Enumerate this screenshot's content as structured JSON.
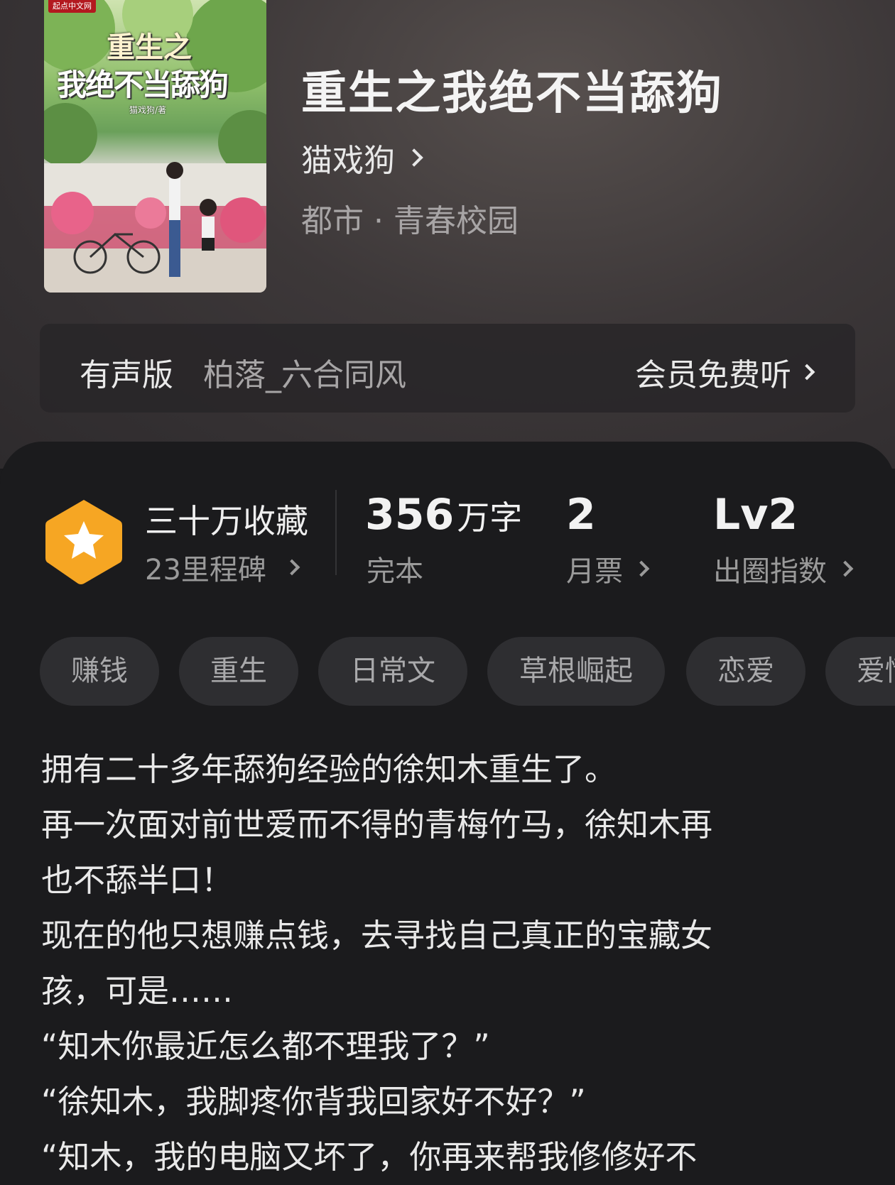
{
  "book": {
    "cover_logo": "起点中文网",
    "cover_title_line1": "重生之",
    "cover_title_line2": "我绝不当舔狗",
    "cover_author": "猫戏狗/著",
    "title": "重生之我绝不当舔狗",
    "author": "猫戏狗",
    "genre": "都市 · 青春校园"
  },
  "audio": {
    "label": "有声版",
    "narrator": "柏落_六合同风",
    "action": "会员免费听"
  },
  "stats": {
    "collect_main": "三十万收藏",
    "collect_sub": "23里程碑",
    "words_value": "356",
    "words_unit": "万字",
    "words_label": "完本",
    "tickets_value": "2",
    "tickets_label": "月票",
    "index_value": "Lv2",
    "index_label": "出圈指数"
  },
  "tags": [
    "赚钱",
    "重生",
    "日常文",
    "草根崛起",
    "恋爱",
    "爱情"
  ],
  "description": [
    "拥有二十多年舔狗经验的徐知木重生了。",
    "再一次面对前世爱而不得的青梅竹马，徐知木再",
    "也不舔半口！",
    "现在的他只想赚点钱，去寻找自己真正的宝藏女",
    "孩，可是……",
    "“知木你最近怎么都不理我了？”",
    "“徐知木，我脚疼你背我回家好不好？”",
    "“知木，我的电脑又坏了，你再来帮我修修好不"
  ],
  "colors": {
    "background": "#1b1b1d",
    "badge_orange": "#f6a623",
    "tag_bg": "#2e2e31"
  }
}
